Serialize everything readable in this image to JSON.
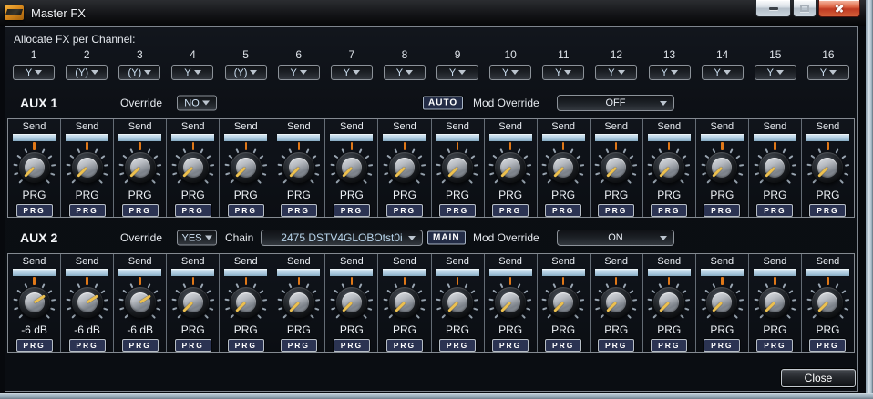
{
  "window": {
    "title": "Master FX"
  },
  "colors": {
    "send_bar_top": "#dcebf5",
    "send_bar": "#a9c7dd",
    "knob_pointer": "#ecc04f",
    "top_tick": "#e07818",
    "prg_button_bg": "#2b3352",
    "dropdown_text": "#cfe2f4",
    "chain_text": "#b8d4ea"
  },
  "allocate": {
    "label": "Allocate FX per Channel:",
    "channels": [
      {
        "num": "1",
        "value": "Y"
      },
      {
        "num": "2",
        "value": "(Y)"
      },
      {
        "num": "3",
        "value": "(Y)"
      },
      {
        "num": "4",
        "value": "Y"
      },
      {
        "num": "5",
        "value": "(Y)"
      },
      {
        "num": "6",
        "value": "Y"
      },
      {
        "num": "7",
        "value": "Y"
      },
      {
        "num": "8",
        "value": "Y"
      },
      {
        "num": "9",
        "value": "Y"
      },
      {
        "num": "10",
        "value": "Y"
      },
      {
        "num": "11",
        "value": "Y"
      },
      {
        "num": "12",
        "value": "Y"
      },
      {
        "num": "13",
        "value": "Y"
      },
      {
        "num": "14",
        "value": "Y"
      },
      {
        "num": "15",
        "value": "Y"
      },
      {
        "num": "16",
        "value": "Y"
      }
    ]
  },
  "aux1": {
    "label": "AUX 1",
    "override_label": "Override",
    "override_value": "NO",
    "auto_button": "AUTO",
    "mod_override_label": "Mod Override",
    "mod_override_value": "OFF",
    "send_label": "Send",
    "channels": [
      {
        "value": "PRG",
        "button": "PRG",
        "knob_angle": -135
      },
      {
        "value": "PRG",
        "button": "PRG",
        "knob_angle": -135
      },
      {
        "value": "PRG",
        "button": "PRG",
        "knob_angle": -135
      },
      {
        "value": "PRG",
        "button": "PRG",
        "knob_angle": -135
      },
      {
        "value": "PRG",
        "button": "PRG",
        "knob_angle": -135
      },
      {
        "value": "PRG",
        "button": "PRG",
        "knob_angle": -135
      },
      {
        "value": "PRG",
        "button": "PRG",
        "knob_angle": -135
      },
      {
        "value": "PRG",
        "button": "PRG",
        "knob_angle": -135
      },
      {
        "value": "PRG",
        "button": "PRG",
        "knob_angle": -135
      },
      {
        "value": "PRG",
        "button": "PRG",
        "knob_angle": -135
      },
      {
        "value": "PRG",
        "button": "PRG",
        "knob_angle": -135
      },
      {
        "value": "PRG",
        "button": "PRG",
        "knob_angle": -135
      },
      {
        "value": "PRG",
        "button": "PRG",
        "knob_angle": -135
      },
      {
        "value": "PRG",
        "button": "PRG",
        "knob_angle": -135
      },
      {
        "value": "PRG",
        "button": "PRG",
        "knob_angle": -135
      },
      {
        "value": "PRG",
        "button": "PRG",
        "knob_angle": -135
      }
    ]
  },
  "aux2": {
    "label": "AUX 2",
    "override_label": "Override",
    "override_value": "YES",
    "chain_label": "Chain",
    "chain_value": "2475 DSTV4GLOBOtst0i",
    "main_button": "MAIN",
    "mod_override_label": "Mod Override",
    "mod_override_value": "ON",
    "send_label": "Send",
    "channels": [
      {
        "value": "-6 dB",
        "button": "PRG",
        "knob_angle": 57
      },
      {
        "value": "-6 dB",
        "button": "PRG",
        "knob_angle": 57
      },
      {
        "value": "-6 dB",
        "button": "PRG",
        "knob_angle": 57
      },
      {
        "value": "PRG",
        "button": "PRG",
        "knob_angle": -135
      },
      {
        "value": "PRG",
        "button": "PRG",
        "knob_angle": -135
      },
      {
        "value": "PRG",
        "button": "PRG",
        "knob_angle": -135
      },
      {
        "value": "PRG",
        "button": "PRG",
        "knob_angle": -135
      },
      {
        "value": "PRG",
        "button": "PRG",
        "knob_angle": -135
      },
      {
        "value": "PRG",
        "button": "PRG",
        "knob_angle": -135
      },
      {
        "value": "PRG",
        "button": "PRG",
        "knob_angle": -135
      },
      {
        "value": "PRG",
        "button": "PRG",
        "knob_angle": -135
      },
      {
        "value": "PRG",
        "button": "PRG",
        "knob_angle": -135
      },
      {
        "value": "PRG",
        "button": "PRG",
        "knob_angle": -135
      },
      {
        "value": "PRG",
        "button": "PRG",
        "knob_angle": -135
      },
      {
        "value": "PRG",
        "button": "PRG",
        "knob_angle": -135
      },
      {
        "value": "PRG",
        "button": "PRG",
        "knob_angle": -135
      }
    ]
  },
  "footer": {
    "close_label": "Close"
  }
}
